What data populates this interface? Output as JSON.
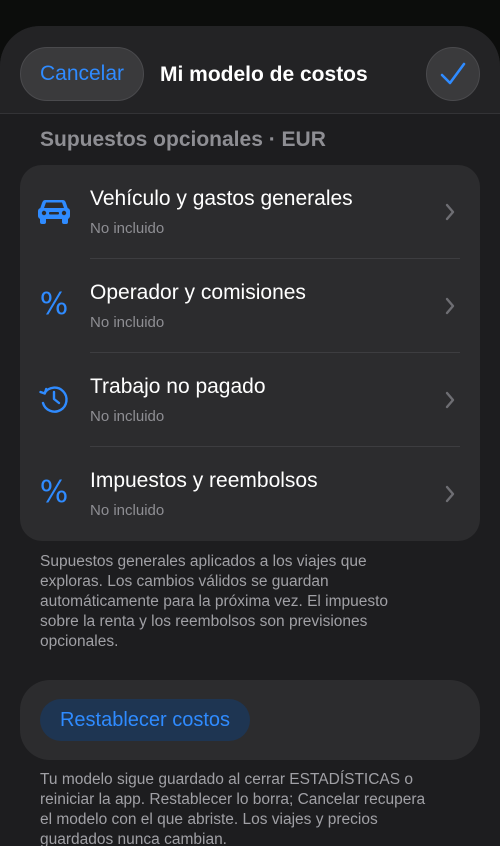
{
  "nav": {
    "cancel_label": "Cancelar",
    "title": "Mi modelo de costos",
    "confirm_icon": "checkmark-icon"
  },
  "section": {
    "title": "Supuestos opcionales · EUR"
  },
  "items": [
    {
      "label": "Vehículo y gastos generales",
      "status": "No incluido",
      "icon": "car-icon"
    },
    {
      "label": "Operador y comisiones",
      "status": "No incluido",
      "icon": "percent-icon"
    },
    {
      "label": "Trabajo no pagado",
      "status": "No incluido",
      "icon": "clock-history-icon"
    },
    {
      "label": "Impuestos y reembolsos",
      "status": "No incluido",
      "icon": "percent-icon"
    }
  ],
  "footnote1": "Supuestos generales aplicados a los viajes que exploras. Los cambios válidos se guardan automáticamente para la próxima vez. El impuesto sobre la renta y los reembolsos son previsiones opcionales.",
  "reset": {
    "label": "Restablecer costos"
  },
  "footnote2": "Tu modelo sigue guardado al cerrar ESTADÍSTICAS o reiniciar la app. Restablecer lo borra; Cancelar recupera el modelo con el que abriste. Los viajes y precios guardados nunca cambian.",
  "colors": {
    "accent": "#2f8bff",
    "background": "#1d1d1f",
    "card": "#2c2c2e",
    "secondary_text": "#8e8e93"
  }
}
